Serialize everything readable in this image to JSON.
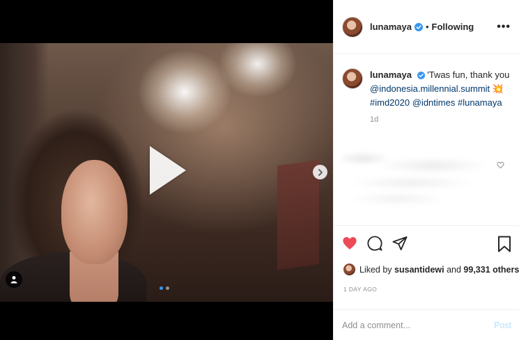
{
  "header": {
    "username": "lunamaya",
    "separator": "•",
    "follow_state": "Following",
    "more_label": "•••"
  },
  "caption": {
    "username": "lunamaya",
    "text_parts": {
      "intro": "'Twas fun, thank you",
      "mention1": "@indonesia.millennial.summit",
      "emoji": "💥",
      "hashtag1": "#imd2020",
      "mention2": "@idntimes",
      "hashtag2": "#lunamaya"
    },
    "time": "1d"
  },
  "likes": {
    "prefix": "Liked by",
    "user": "susantidewi",
    "conjunction": "and",
    "count": "99,331 others"
  },
  "post_date": "1 DAY AGO",
  "comment": {
    "placeholder": "Add a comment...",
    "post_label": "Post"
  },
  "carousel": {
    "total": 2,
    "active": 1
  },
  "colors": {
    "like_red": "#ed4956",
    "verified_blue": "#3897f0",
    "link_blue": "#00376b",
    "post_disabled": "#b2dffc"
  },
  "icons": {
    "play": "play-icon",
    "next": "chevron-right-icon",
    "tag": "user-tag-icon",
    "like": "heart-icon",
    "comment": "comment-icon",
    "share": "paper-plane-icon",
    "save": "bookmark-icon"
  }
}
